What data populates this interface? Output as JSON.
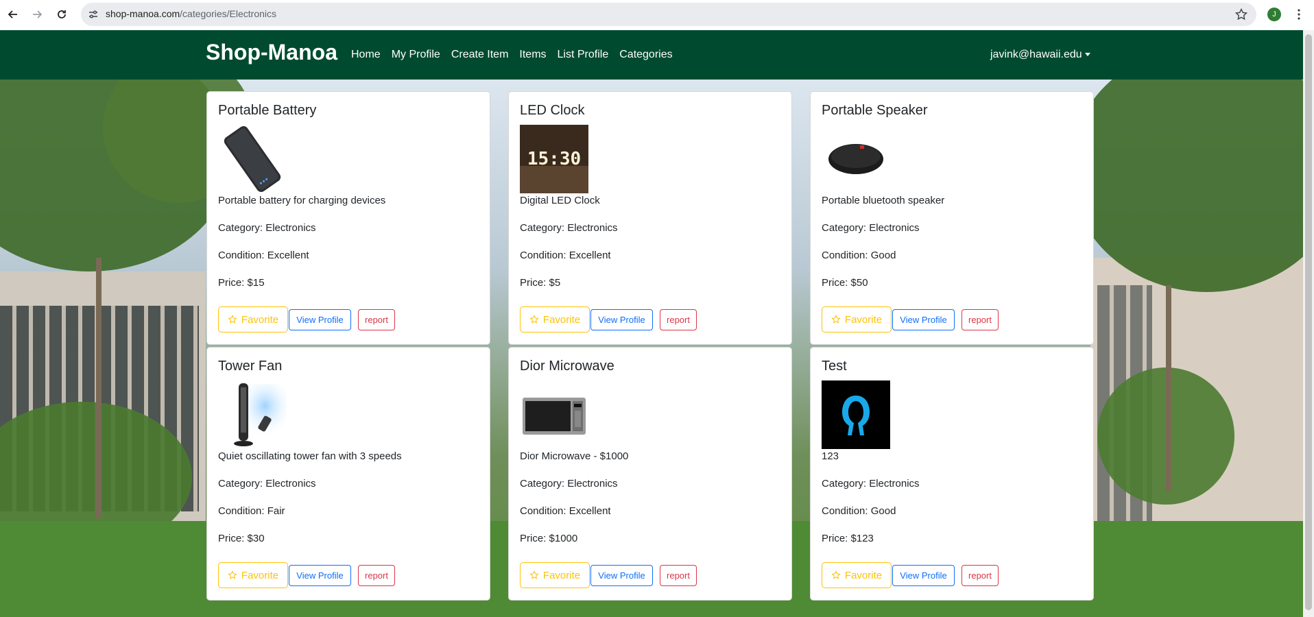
{
  "browser": {
    "url_host": "shop-manoa.com",
    "url_path": "/categories/Electronics",
    "profile_initial": "J"
  },
  "navbar": {
    "brand": "Shop-Manoa",
    "links": [
      "Home",
      "My Profile",
      "Create Item",
      "Items",
      "List Profile",
      "Categories"
    ],
    "user": "javink@hawaii.edu"
  },
  "items": [
    {
      "title": "Portable Battery",
      "image": "power-bank-image",
      "description": "Portable battery for charging devices",
      "category": "Category: Electronics",
      "condition": "Condition: Excellent",
      "price": "Price: $15",
      "favorite_label": "Favorite",
      "view_label": "View Profile",
      "report_label": "report"
    },
    {
      "title": "LED Clock",
      "image": "led-clock-image",
      "description": "Digital LED Clock",
      "category": "Category: Electronics",
      "condition": "Condition: Excellent",
      "price": "Price: $5",
      "favorite_label": "Favorite",
      "view_label": "View Profile",
      "report_label": "report"
    },
    {
      "title": "Portable Speaker",
      "image": "speaker-image",
      "description": "Portable bluetooth speaker",
      "category": "Category: Electronics",
      "condition": "Condition: Good",
      "price": "Price: $50",
      "favorite_label": "Favorite",
      "view_label": "View Profile",
      "report_label": "report"
    },
    {
      "title": "Tower Fan",
      "image": "tower-fan-image",
      "description": "Quiet oscillating tower fan with 3 speeds",
      "category": "Category: Electronics",
      "condition": "Condition: Fair",
      "price": "Price: $30",
      "favorite_label": "Favorite",
      "view_label": "View Profile",
      "report_label": "report"
    },
    {
      "title": "Dior Microwave",
      "image": "microwave-image",
      "description": "Dior Microwave - $1000",
      "category": "Category: Electronics",
      "condition": "Condition: Excellent",
      "price": "Price: $1000",
      "favorite_label": "Favorite",
      "view_label": "View Profile",
      "report_label": "report"
    },
    {
      "title": "Test",
      "image": "test-logo-image",
      "description": "123",
      "category": "Category: Electronics",
      "condition": "Condition: Good",
      "price": "Price: $123",
      "favorite_label": "Favorite",
      "view_label": "View Profile",
      "report_label": "report"
    }
  ],
  "colors": {
    "navbar": "#004b2f",
    "favorite": "#ffc107",
    "view": "#0d6efd",
    "report": "#dc3545"
  }
}
